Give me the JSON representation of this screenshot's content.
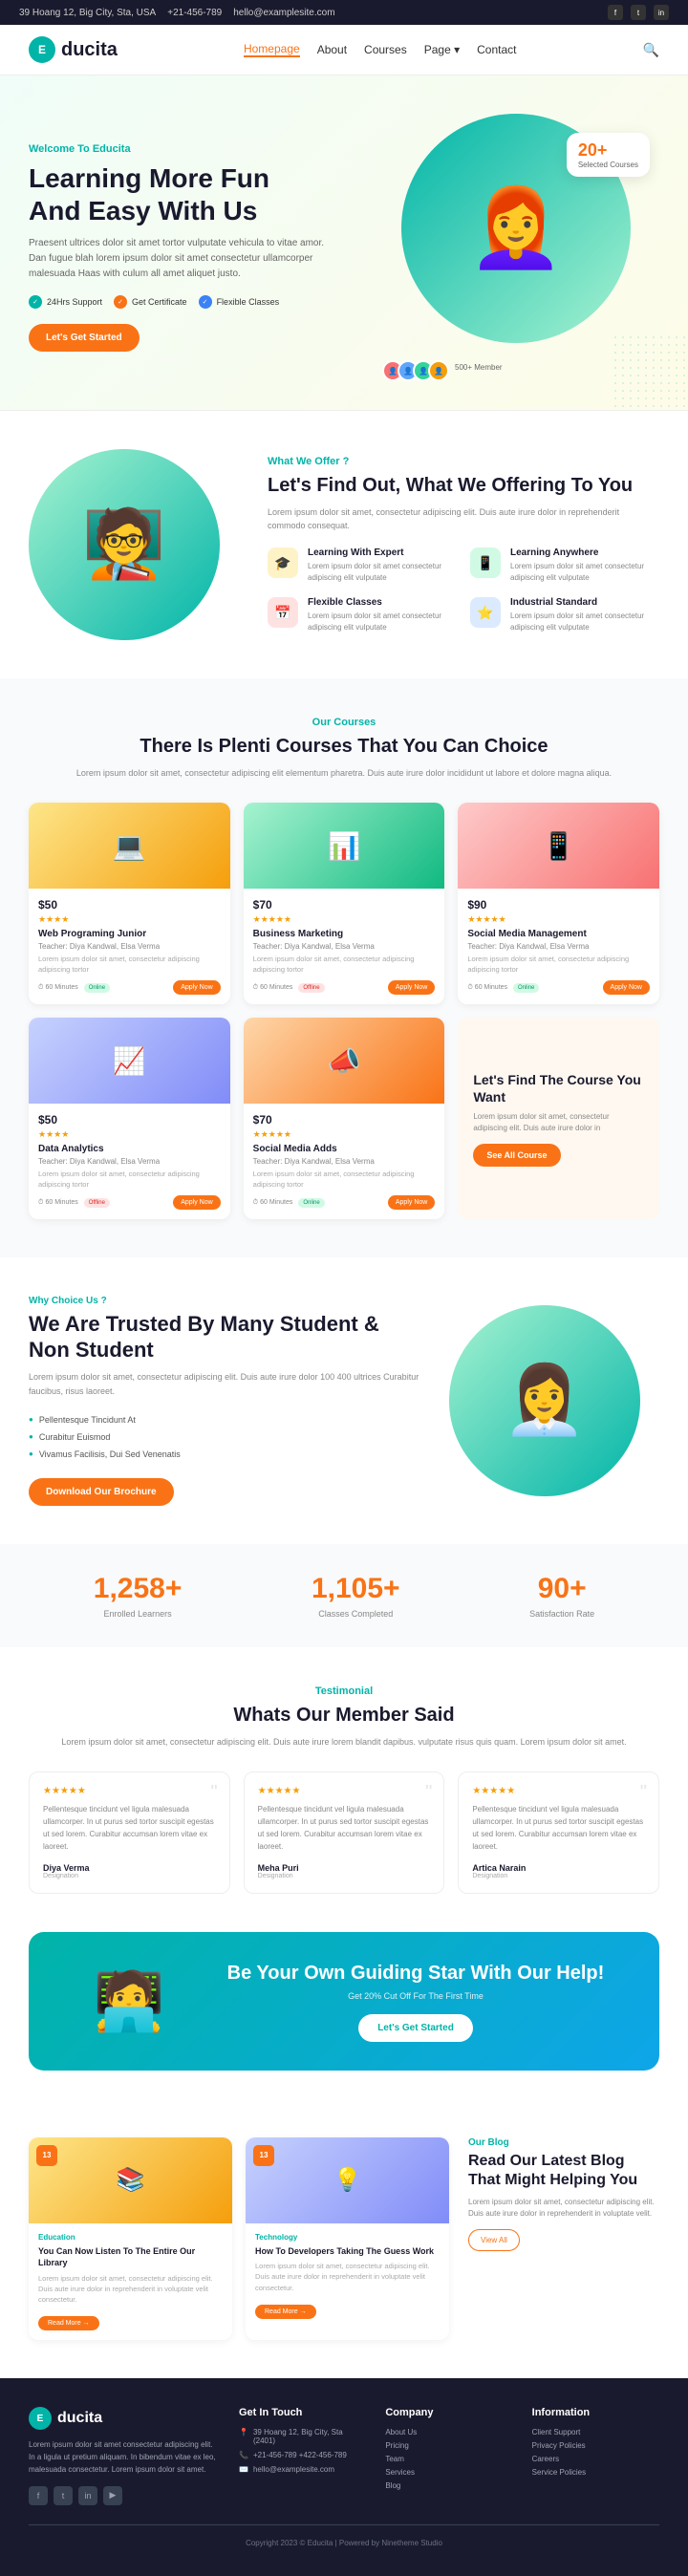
{
  "topbar": {
    "address": "39 Hoang 12, Big City, Sta, USA",
    "phone": "+21-456-789",
    "email": "hello@examplesite.com",
    "social": [
      "f",
      "t",
      "in"
    ]
  },
  "navbar": {
    "logo_letter": "E",
    "logo_text": "ducita",
    "links": [
      {
        "label": "Homepage",
        "active": true
      },
      {
        "label": "About"
      },
      {
        "label": "Courses"
      },
      {
        "label": "Page ▾"
      },
      {
        "label": "Contact"
      }
    ],
    "search_icon": "🔍"
  },
  "hero": {
    "welcome": "Welcome To Educita",
    "title_line1": "Learning More Fun",
    "title_line2": "And Easy With Us",
    "description": "Praesent ultrices dolor sit amet tortor vulputate vehicula to vitae amor. Dan fugue blah lorem ipsum dolor sit amet consectetur ullamcorper malesuada Haas with culum all amet aliquet justo.",
    "badge1": "24Hrs Support",
    "badge2": "Get Certificate",
    "badge3": "Flexible Classes",
    "cta_button": "Let's Get Started",
    "float_number": "20+",
    "float_text": "Selected Courses",
    "members_count": "500+ Member"
  },
  "what_offer": {
    "subtitle": "What We Offer ?",
    "title": "Let's Find Out, What We Offering To You",
    "description": "Lorem ipsum dolor sit amet, consectetur adipiscing elit. Duis aute irure dolor in reprehenderit commodo consequat.",
    "items": [
      {
        "icon": "🎓",
        "color": "yellow",
        "title": "Learning With Expert",
        "desc": "Lorem ipsum dolor sit amet consectetur adipiscing elit vulputate"
      },
      {
        "icon": "📱",
        "color": "green",
        "title": "Learning Anywhere",
        "desc": "Lorem ipsum dolor sit amet consectetur adipiscing elit vulputate"
      },
      {
        "icon": "📅",
        "color": "red",
        "title": "Flexible Classes",
        "desc": "Lorem ipsum dolor sit amet consectetur adipiscing elit vulputate"
      },
      {
        "icon": "⭐",
        "color": "blue",
        "title": "Industrial Standard",
        "desc": "Lorem ipsum dolor sit amet consectetur adipiscing elit vulputate"
      }
    ]
  },
  "courses": {
    "subtitle": "Our Courses",
    "title": "There Is Plenti Courses That You Can Choice",
    "description": "Lorem ipsum dolor sit amet, consectetur adipiscing elit elementum pharetra. Duis aute irure dolor incididunt ut labore et dolore magna aliqua.",
    "items": [
      {
        "price": "$50",
        "stars": "★★★★",
        "title": "Web Programing Junior",
        "teacher": "Teacher: Diya Kandwal, Elsa Verma",
        "desc": "Lorem ipsum dolor sit amet, consectetur adipiscing adipiscing tortor",
        "minutes": "60 Minutes",
        "mode": "Online",
        "mode_type": "online",
        "img_class": "img1",
        "emoji": "💻"
      },
      {
        "price": "$70",
        "stars": "★★★★★",
        "title": "Business Marketing",
        "teacher": "Teacher: Diya Kandwal, Elsa Verma",
        "desc": "Lorem ipsum dolor sit amet, consectetur adipiscing adipiscing tortor",
        "minutes": "60 Minutes",
        "mode": "Offline",
        "mode_type": "offline",
        "img_class": "img2",
        "emoji": "📊"
      },
      {
        "price": "$90",
        "stars": "★★★★★",
        "title": "Social Media Management",
        "teacher": "Teacher: Diya Kandwal, Elsa Verma",
        "desc": "Lorem ipsum dolor sit amet, consectetur adipiscing adipiscing tortor",
        "minutes": "60 Minutes",
        "mode": "Online",
        "mode_type": "online",
        "img_class": "img3",
        "emoji": "📱"
      },
      {
        "price": "$50",
        "stars": "★★★★",
        "title": "Data Analytics",
        "teacher": "Teacher: Diya Kandwal, Elsa Verma",
        "desc": "Lorem ipsum dolor sit amet, consectetur adipiscing adipiscing tortor",
        "minutes": "60 Minutes",
        "mode": "Offline",
        "mode_type": "offline",
        "img_class": "img4",
        "emoji": "📈"
      },
      {
        "price": "$70",
        "stars": "★★★★★",
        "title": "Social Media Adds",
        "teacher": "Teacher: Diya Kandwal, Elsa Verma",
        "desc": "Lorem ipsum dolor sit amet, consectetur adipiscing adipiscing tortor",
        "minutes": "60 Minutes",
        "mode": "Online",
        "mode_type": "online",
        "img_class": "img5",
        "emoji": "📣"
      }
    ],
    "find_course_title": "Let's Find The Course You Want",
    "find_course_desc": "Lorem ipsum dolor sit amet, consectetur adipiscing elit. Duis aute irure dolor in",
    "see_all_btn": "See All Course",
    "apply_btn": "Apply Now"
  },
  "why_choose": {
    "subtitle": "Why Choice Us ?",
    "title": "We Are Trusted By Many Student & Non Student",
    "description": "Lorem ipsum dolor sit amet, consectetur adipiscing elit. Duis aute irure dolor 100 400 ultrices Curabitur faucibus, risus laoreet.",
    "list": [
      "Pellentesque Tincidunt At",
      "Curabitur Euismod",
      "Vivamus Facilisis, Dui Sed Venenatis"
    ],
    "download_btn": "Download Our Brochure"
  },
  "stats": [
    {
      "number": "1,258+",
      "label": "Enrolled Learners"
    },
    {
      "number": "1,105+",
      "label": "Classes Completed"
    },
    {
      "number": "90+",
      "label": "Satisfaction Rate"
    }
  ],
  "testimonials": {
    "subtitle": "Testimonial",
    "title": "Whats Our Member Said",
    "description": "Lorem ipsum dolor sit amet, consectetur adipiscing elit. Duis aute irure lorem blandit dapibus. vulputate risus quis quam. Lorem ipsum dolor sit amet.",
    "items": [
      {
        "stars": "★★★★★",
        "text": "Pellentesque tincidunt vel ligula malesuada ullamcorper. In ut purus sed tortor suscipit egestas ut sed lorem. Curabitur accumsan lorem vitae ex laoreet.",
        "author": "Diya Verma",
        "role": "Designation"
      },
      {
        "stars": "★★★★★",
        "text": "Pellentesque tincidunt vel ligula malesuada ullamcorper. In ut purus sed tortor suscipit egestas ut sed lorem. Curabitur accumsan lorem vitae ex laoreet.",
        "author": "Meha Puri",
        "role": "Designation"
      },
      {
        "stars": "★★★★★",
        "text": "Pellentesque tincidunt vel ligula malesuada ullamcorper. In ut purus sed tortor suscipit egestas ut sed lorem. Curabitur accumsan lorem vitae ex laoreet.",
        "author": "Artica Narain",
        "role": "Designation"
      }
    ]
  },
  "cta": {
    "title": "Be Your Own Guiding Star With Our Help!",
    "desc": "Get 20% Cut Off For The First Time",
    "btn": "Let's Get Started"
  },
  "blog": {
    "subtitle": "Our Blog",
    "title": "Read Our Latest Blog That Might Helping You",
    "description": "Lorem ipsum dolor sit amet, consectetur adipiscing elit. Duis aute irure dolor in reprehenderit in voluptate velit.",
    "view_all": "View All",
    "items": [
      {
        "date": "13",
        "category": "Education",
        "title": "You Can Now Listen To The Entire Our Library",
        "desc": "Lorem ipsum dolor sit amet, consectetur adipiscing elit. Duis aute irure dolor in reprehenderit in voluptate velit consectetur.",
        "btn": "Read More →",
        "img_class": "img1",
        "emoji": "📚"
      },
      {
        "date": "13",
        "category": "Technology",
        "title": "How To Developers Taking The Guess Work",
        "desc": "Lorem ipsum dolor sit amet, consectetur adipiscing elit. Duis aute irure dolor in reprehenderit in voluptate velit consectetur.",
        "btn": "Read More →",
        "img_class": "img2",
        "emoji": "💡"
      }
    ]
  },
  "footer": {
    "logo_letter": "E",
    "logo_text": "ducita",
    "description": "Lorem ipsum dolor sit amet consectetur adipiscing elit. In a ligula ut pretium aliquam. In bibendum vitae ex leo, malesuada consectetur. Lorem ipsum dolor sit amet.",
    "social_icons": [
      "f",
      "t",
      "in",
      "yt"
    ],
    "col2_title": "Get In Touch",
    "col2_items": [
      {
        "icon": "📍",
        "text": "39 Hoang 12, Big City, Sta (2401)"
      },
      {
        "icon": "📞",
        "text": "+21-456-789\n+422-456-789"
      },
      {
        "icon": "✉️",
        "text": "hello@examplesite.com"
      }
    ],
    "col3_title": "Company",
    "col3_links": [
      "About Us",
      "Pricing",
      "Team",
      "Services",
      "Blog"
    ],
    "col4_title": "Information",
    "col4_links": [
      "Client Support",
      "Privacy Policies",
      "Careers",
      "Service Policies"
    ],
    "copyright": "Copyright 2023 © Educita | Powered by Ninetheme Studio"
  }
}
